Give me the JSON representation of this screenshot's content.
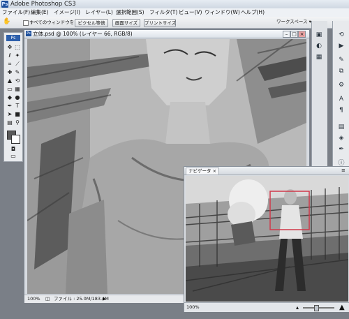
{
  "window": {
    "title": "Adobe Photoshop CS3",
    "logo_text": "Ps"
  },
  "menubar": {
    "items": [
      "ファイル(F)",
      "編集(E)",
      "イメージ(I)",
      "レイヤー(L)",
      "選択範囲(S)",
      "フィルタ(T)",
      "ビュー(V)",
      "ウィンドウ(W)",
      "ヘルプ(H)"
    ]
  },
  "options": {
    "scroll_all_label": "すべてのウィンドウをスクロール",
    "actual_pixels": "ピクセル等倍",
    "fit_screen": "画面サイズ",
    "print_size": "プリントサイズ",
    "workspace": "ワークスペース ▾"
  },
  "toolbox": {
    "badge": "Ps"
  },
  "document": {
    "title": "立体.psd @ 100% (レイヤー 66, RGB/8)",
    "zoom": "100%",
    "file_info": "ファイル : 25.0M/183.4M"
  },
  "navigator": {
    "tab_label": "ナビゲータ ×",
    "zoom": "100%",
    "zoom_slider_level": 0.4
  },
  "colors": {
    "accent": "#1d4f9c",
    "nav_proxy": "#d0394a"
  }
}
